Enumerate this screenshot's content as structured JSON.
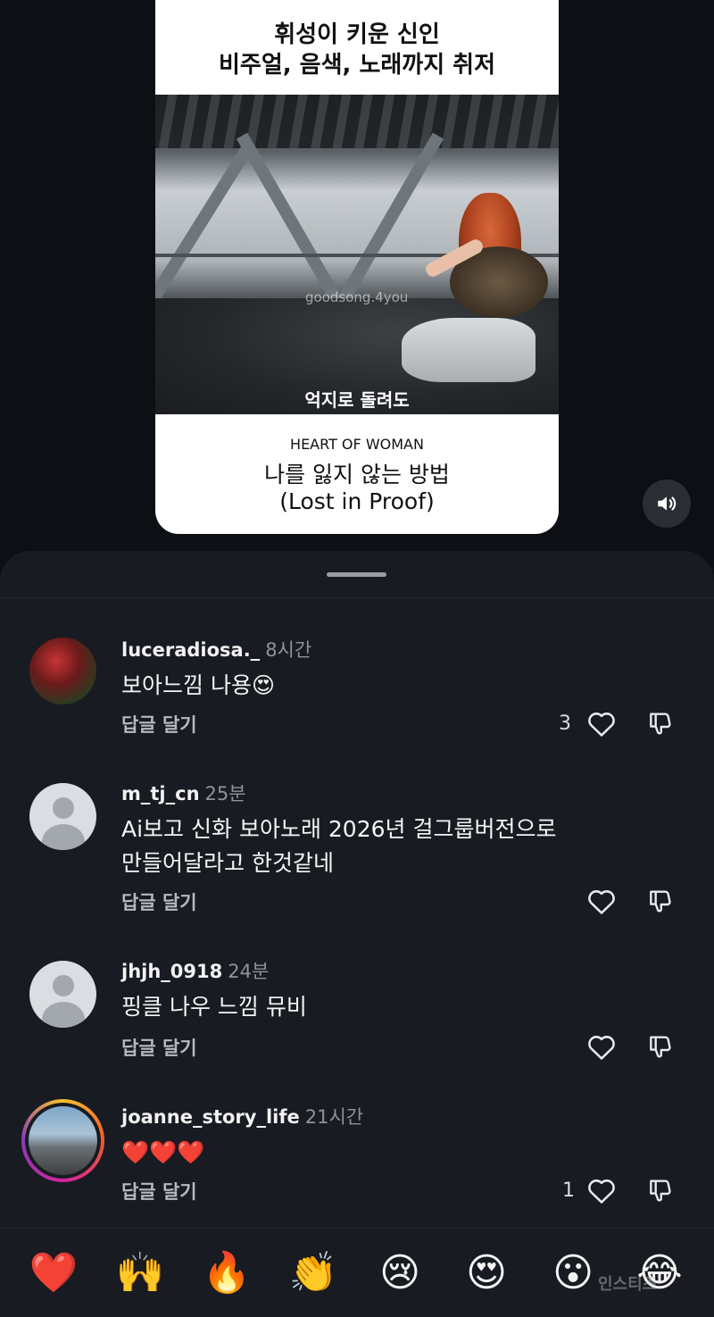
{
  "video": {
    "headline_line1": "휘성이 키운 신인",
    "headline_line2": "비주얼, 음색, 노래까지 취저",
    "watermark": "goodsong.4you",
    "caption": "억지로 돌려도",
    "artist": "HEART OF WOMAN",
    "title_line1": "나를 잃지 않는 방법",
    "title_line2": "(Lost in Proof)"
  },
  "comments": [
    {
      "username": "luceradiosa._",
      "time": "8시간",
      "text": "보아느낌 나용😍",
      "reply_label": "답글 달기",
      "like_count": "3",
      "avatar": "photo"
    },
    {
      "username": "m_tj_cn",
      "time": "25분",
      "text_line1": "Ai보고 신화 보아노래 2026년 걸그룹버전으로",
      "text_line2": "만들어달라고 한것같네",
      "reply_label": "답글 달기",
      "like_count": "",
      "avatar": "default"
    },
    {
      "username": "jhjh_0918",
      "time": "24분",
      "text": "핑클 나우 느낌 뮤비",
      "reply_label": "답글 달기",
      "like_count": "",
      "avatar": "default"
    },
    {
      "username": "joanne_story_life",
      "time": "21시간",
      "text": "❤️❤️❤️",
      "reply_label": "답글 달기",
      "like_count": "1",
      "avatar": "story"
    }
  ],
  "emoji_bar": [
    "❤️",
    "🙌",
    "🔥",
    "👏",
    "😢",
    "😍",
    "😮",
    "😂"
  ],
  "brand_watermark": "인스티즈",
  "colors": {
    "background": "#0c0f14",
    "sheet": "#181b21",
    "secondary_text": "#8e939b"
  },
  "icons": [
    "speaker-icon",
    "heart-outline-icon",
    "dislike-icon"
  ]
}
